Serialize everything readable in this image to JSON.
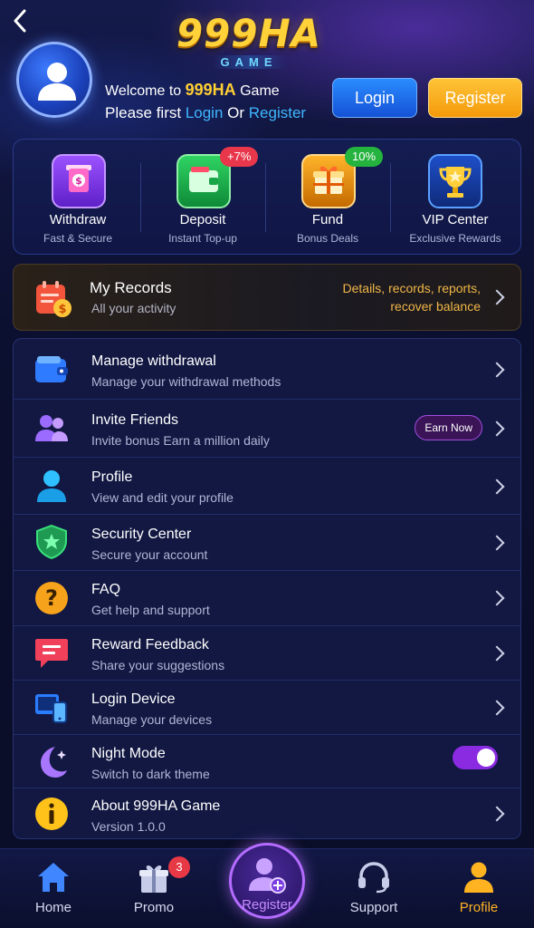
{
  "header": {
    "logo_main": "999HA",
    "logo_sub": "GAME",
    "welcome_prefix": "Welcome to ",
    "brand": "999HA",
    "welcome_suffix": " Game",
    "please_first": "Please first ",
    "login_link": "Login",
    "or": " Or ",
    "register_link": "Register",
    "login_button": "Login",
    "register_button": "Register"
  },
  "quick_actions": [
    {
      "title": "Withdraw",
      "subtitle": "Fast & Secure",
      "icon": "withdraw-icon"
    },
    {
      "title": "Deposit",
      "subtitle": "Instant Top-up",
      "icon": "wallet-icon",
      "badge": "+7%"
    },
    {
      "title": "Fund",
      "subtitle": "Bonus Deals",
      "icon": "gift-icon",
      "badge": "10%"
    },
    {
      "title": "VIP Center",
      "subtitle": "Exclusive Rewards",
      "icon": "trophy-icon"
    }
  ],
  "records": {
    "title": "My Records",
    "subtitle": "All your activity",
    "right_line1": "Details, records, reports,",
    "right_line2": "recover balance"
  },
  "menu": [
    {
      "title": "Manage withdrawal",
      "subtitle": "Manage your withdrawal methods",
      "icon": "wallet-icon"
    },
    {
      "title": "Invite Friends",
      "subtitle": "Invite bonus Earn a million daily",
      "icon": "users-icon",
      "pill": "Earn Now"
    },
    {
      "title": "Profile",
      "subtitle": "View and edit your profile",
      "icon": "user-icon"
    },
    {
      "title": "Security Center",
      "subtitle": "Secure your account",
      "icon": "shield-icon"
    },
    {
      "title": "FAQ",
      "subtitle": "Get help and support",
      "icon": "question-icon"
    },
    {
      "title": "Reward Feedback",
      "subtitle": "Share your suggestions",
      "icon": "chat-icon"
    },
    {
      "title": "Login Device",
      "subtitle": "Manage your devices",
      "icon": "devices-icon"
    },
    {
      "title": "Night Mode",
      "subtitle": "Switch to dark theme",
      "icon": "moon-icon",
      "toggle_on": true
    },
    {
      "title": "About 999HA Game",
      "subtitle": "Version 1.0.0",
      "icon": "info-icon"
    }
  ],
  "nav": {
    "home": "Home",
    "promo": "Promo",
    "promo_badge": "3",
    "register": "Register",
    "support": "Support",
    "profile": "Profile"
  },
  "colors": {
    "accent_gold": "#ffcf33",
    "accent_blue": "#3fb7ff",
    "accent_purple": "#8a2be2",
    "background": "#0b0f2e"
  }
}
